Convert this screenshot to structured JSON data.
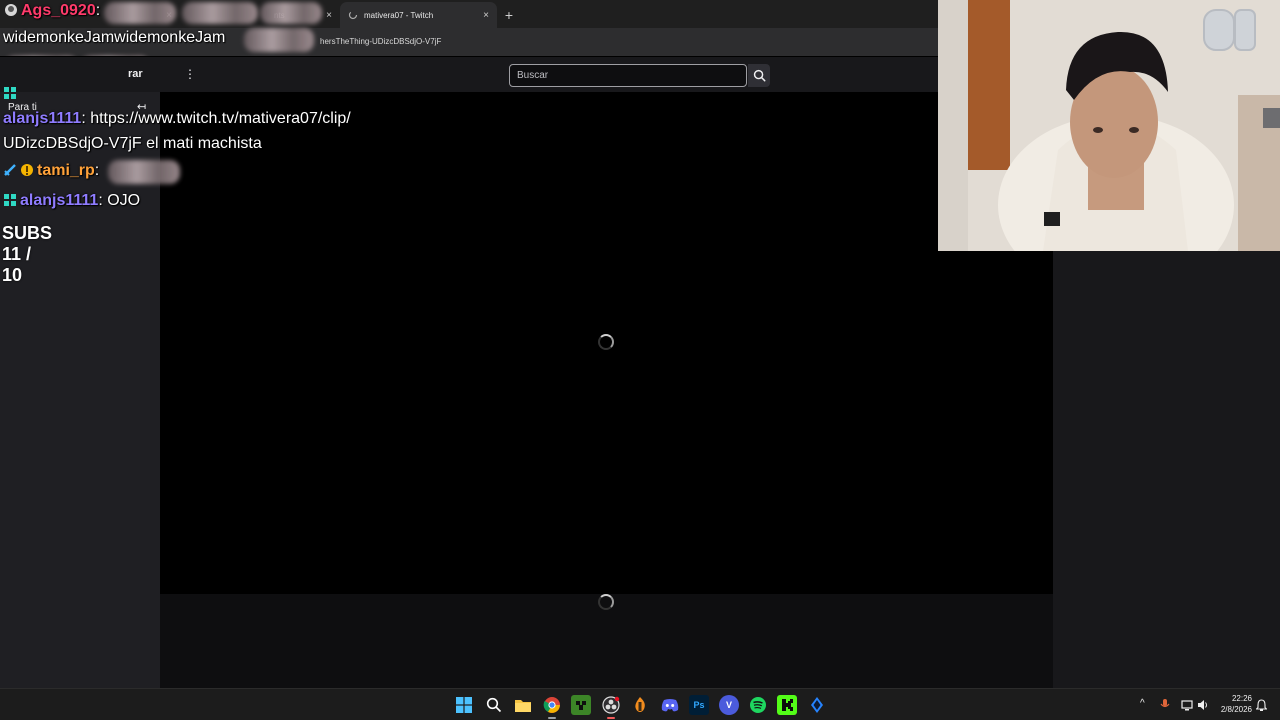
{
  "browser": {
    "tabs": [
      {
        "label": "",
        "active": false
      },
      {
        "label": "nts",
        "active": false
      },
      {
        "label": "mativera07 - Twitch",
        "active": true
      }
    ],
    "new_tab": "+",
    "close_glyph": "×",
    "url": "hersTheThing-UDizcDBSdjO-V7jF"
  },
  "twitch": {
    "explore_label": "rar",
    "search_placeholder": "Buscar",
    "sidebar_heading": "Para ti",
    "collapse_glyph": "↤",
    "menu_glyph": "⋮"
  },
  "chat": {
    "messages": [
      {
        "user": "Ags_0920",
        "sep": ":",
        "text": ""
      },
      {
        "user": "",
        "sep": "",
        "text": "widemonkeJamwidemonkeJam"
      },
      {
        "user": "alanjs1111",
        "sep": ":",
        "text": " https://www.twitch.tv/mativera07/clip/"
      },
      {
        "user": "",
        "sep": "",
        "text": "UDizcDBSdjO-V7jF el mati machista"
      },
      {
        "user": "tami_rp",
        "sep": ":",
        "text": ""
      },
      {
        "user": "alanjs1111",
        "sep": ":",
        "text": " OJO"
      }
    ],
    "subs_label": "SUBS 11 / 10"
  },
  "taskbar": {
    "icons": [
      "windows-start-icon",
      "search-icon",
      "file-explorer-icon",
      "chrome-icon",
      "minecraft-icon",
      "obs-icon",
      "fl-studio-icon",
      "discord-icon",
      "photoshop-icon",
      "vivaldi-icon",
      "spotify-icon",
      "kick-icon",
      "sourcetree-icon"
    ],
    "ps_label": "Ps",
    "v_label": "V",
    "tray_chevron": "^",
    "clock_time": "22:26",
    "clock_date": "2/8/2026"
  },
  "colors": {
    "accent": "#9147ff",
    "chat_blue": "#8f7cff",
    "chat_red": "#ff3b6b",
    "chat_orange": "#ffa23a"
  }
}
